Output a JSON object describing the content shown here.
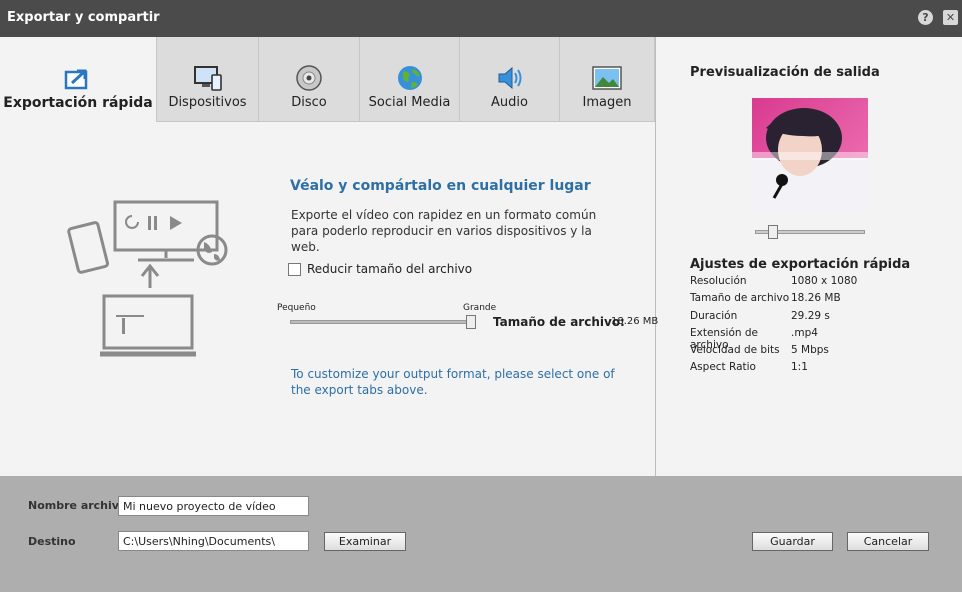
{
  "window": {
    "title": "Exportar y compartir",
    "help_glyph": "?",
    "close_glyph": "✕"
  },
  "tabs": [
    {
      "label": "Exportación rápida",
      "icon": "quick-export-icon"
    },
    {
      "label": "Dispositivos",
      "icon": "devices-icon"
    },
    {
      "label": "Disco",
      "icon": "disc-icon"
    },
    {
      "label": "Social Media",
      "icon": "globe-icon"
    },
    {
      "label": "Audio",
      "icon": "speaker-icon"
    },
    {
      "label": "Imagen",
      "icon": "image-icon"
    }
  ],
  "main": {
    "headline": "Véalo y compártalo en cualquier lugar",
    "description": "Exporte el vídeo con rapidez en un formato común para poderlo reproducir en varios dispositivos y la web.",
    "reduce_label": "Reducir tamaño del archivo",
    "reduce_checked": false,
    "size_small": "Pequeño",
    "size_large": "Grande",
    "filesize_label": "Tamaño de archivo:",
    "filesize_value": "18.26 MB",
    "note": "To customize your output format, please select one of the export tabs above."
  },
  "preview": {
    "title": "Previsualización de salida",
    "settings_title": "Ajustes de exportación rápida",
    "settings": [
      {
        "key": "Resolución",
        "value": "1080 x 1080"
      },
      {
        "key": "Tamaño de archivo",
        "value": "18.26 MB"
      },
      {
        "key": "Duración",
        "value": "29.29 s"
      },
      {
        "key": "Extensión de archivo",
        "value": ".mp4"
      },
      {
        "key": "Velocidad de bits",
        "value": "5 Mbps"
      },
      {
        "key": "Aspect Ratio",
        "value": "1:1"
      }
    ]
  },
  "bottom": {
    "filename_label": "Nombre archivo:",
    "filename_value": "Mi nuevo proyecto de vídeo",
    "dest_label": "Destino",
    "dest_value": "C:\\Users\\Nhing\\Documents\\",
    "browse_label": "Examinar",
    "save_label": "Guardar",
    "cancel_label": "Cancelar"
  },
  "colors": {
    "titlebar": "#4b4b4b",
    "accent_blue": "#2d6fa6",
    "bottom_bar": "#aeaeae"
  }
}
